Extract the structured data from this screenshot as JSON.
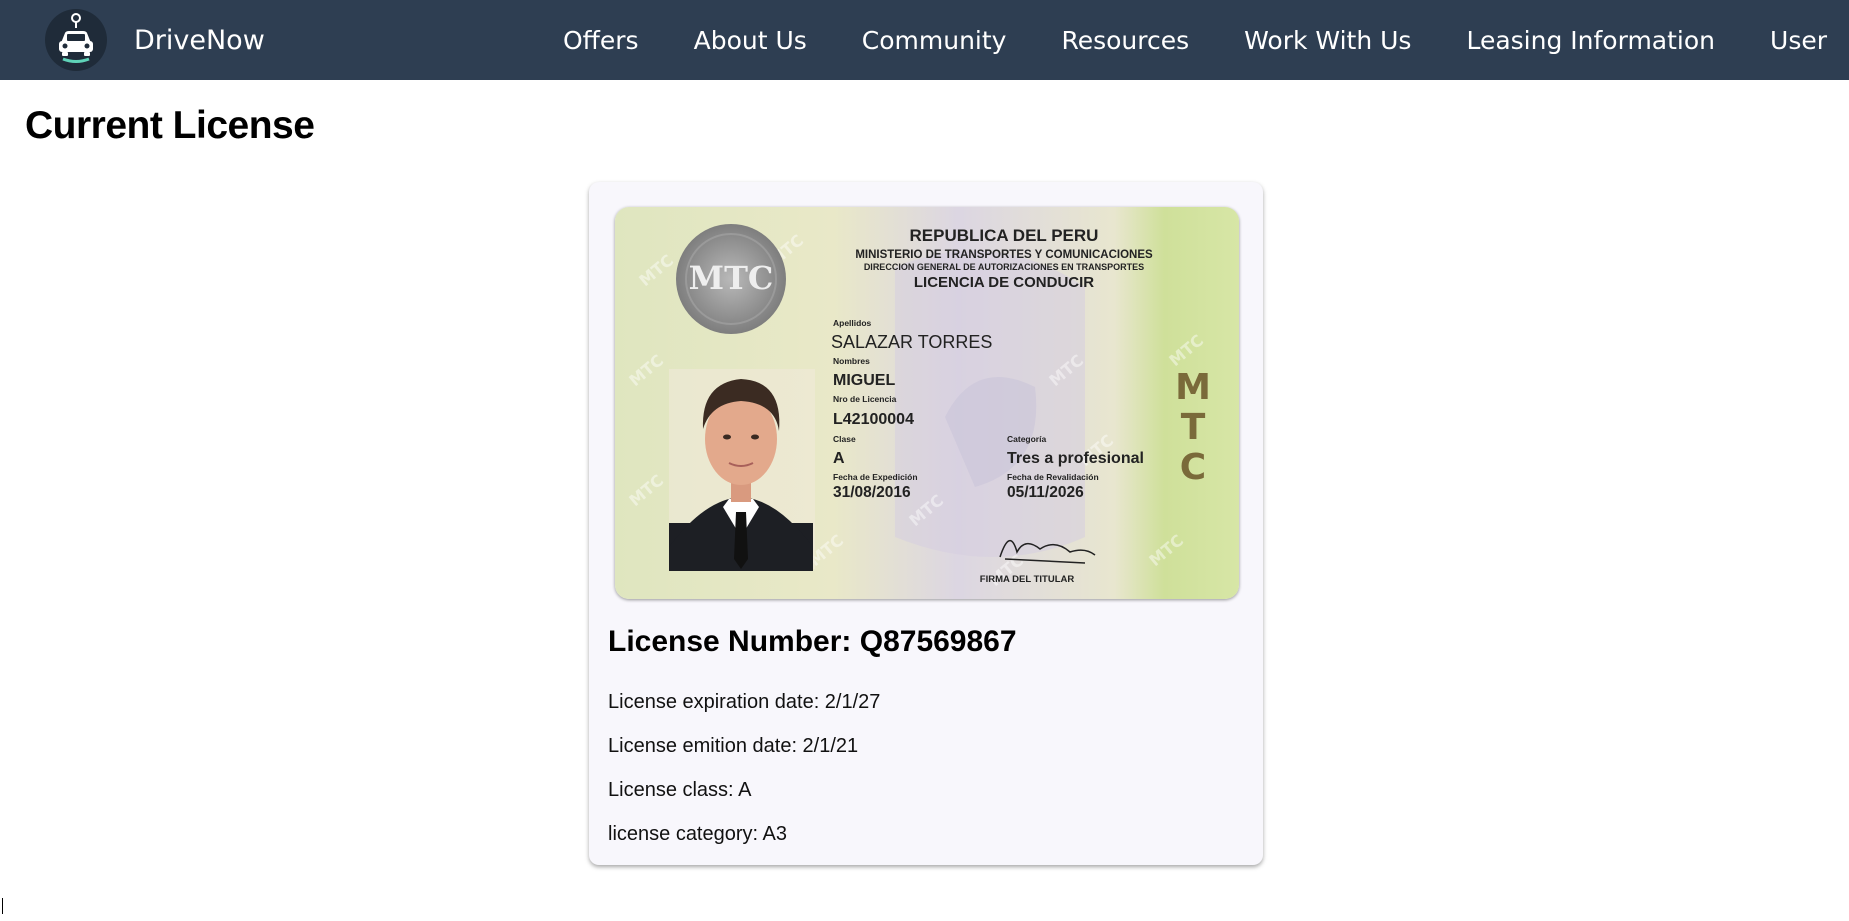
{
  "app": {
    "brand_name": "DriveNow"
  },
  "nav": {
    "items": [
      {
        "label": "Offers"
      },
      {
        "label": "About Us"
      },
      {
        "label": "Community"
      },
      {
        "label": "Resources"
      },
      {
        "label": "Work With Us"
      },
      {
        "label": "Leasing Information"
      },
      {
        "label": "User"
      }
    ]
  },
  "main": {
    "title": "Current License"
  },
  "license": {
    "heading": "License Number: Q87569867",
    "expiration": "License expiration date: 2/1/27",
    "emition": "License emition date: 2/1/21",
    "class": "License class: A",
    "category": "license category: A3",
    "card_image": {
      "country": "REPUBLICA DEL PERU",
      "ministry": "MINISTERIO DE TRANSPORTES Y COMUNICACIONES",
      "direction": "DIRECCION GENERAL DE AUTORIZACIONES EN TRANSPORTES",
      "doc_title": "LICENCIA DE CONDUCIR",
      "surname_label": "Apellidos",
      "surname": "SALAZAR TORRES",
      "names_label": "Nombres",
      "names": "MIGUEL",
      "number_label": "Nro de Licencia",
      "number": "L42100004",
      "class_label": "Clase",
      "class": "A",
      "category_label": "Categoría",
      "category": "Tres a profesional",
      "issue_label": "Fecha de Expedición",
      "issue_date": "31/08/2016",
      "reval_label": "Fecha de Revalidación",
      "reval_date": "05/11/2026",
      "signature_label": "FIRMA DEL TITULAR",
      "side_mark": "MTC"
    }
  },
  "colors": {
    "navbar": "#2e3e52",
    "card_bg": "#f8f7fc"
  }
}
